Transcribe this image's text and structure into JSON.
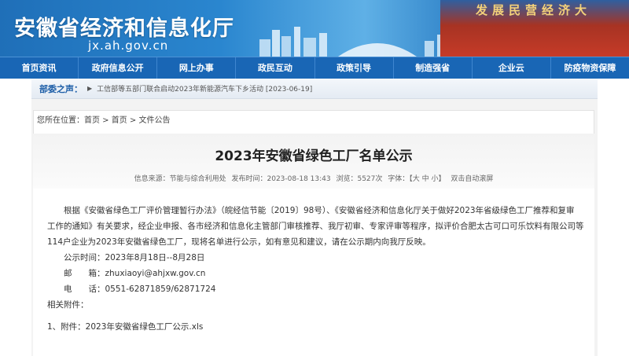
{
  "header": {
    "title": "安徽省经济和信息化厅",
    "domain": "jx.ah.gov.cn",
    "banner_text": "发展民营经济大"
  },
  "nav": {
    "items": [
      {
        "label": "首页资讯"
      },
      {
        "label": "政府信息公开"
      },
      {
        "label": "网上办事"
      },
      {
        "label": "政民互动"
      },
      {
        "label": "政策引导"
      },
      {
        "label": "制造强省"
      },
      {
        "label": "企业云"
      },
      {
        "label": "防疫物资保障"
      }
    ]
  },
  "ticker": {
    "title": "部委之声：",
    "text": "工信部等五部门联合启动2023年新能源汽车下乡活动 [2023-06-19]"
  },
  "breadcrumb": "您所在位置：首页 > 首页 > 文件公告",
  "article": {
    "title": "2023年安徽省绿色工厂名单公示",
    "meta": {
      "source": "信息来源：节能与综合利用处",
      "date": "发布时间：2023-08-18 13:43",
      "views": "浏览：5527次",
      "font": "字体：【大 中 小】",
      "scroll": "双击自动滚屏"
    },
    "lines": [
      "　　根据《安徽省绿色工厂评价管理暂行办法》（皖经信节能〔2019〕98号）、《安徽省经济和信息化厅关于做好2023年省级绿色工厂推荐和复审",
      "工作的通知》有关要求，经企业申报、各市经济和信息化主管部门审核推荐、我厅初审、专家评审等程序，拟评价合肥太古可口可乐饮料有限公司等",
      "114户企业为2023年安徽省绿色工厂，现将名单进行公示，如有意见和建议，请在公示期内向我厅反映。",
      "　　公示时间：2023年8月18日--8月28日",
      "　　邮　　箱：zhuxiaoyi@ahjxw.gov.cn",
      "　　电　　话：0551-62871859/62871724",
      "相关附件：",
      "1、附件：2023年安徽省绿色工厂公示.xls"
    ]
  }
}
